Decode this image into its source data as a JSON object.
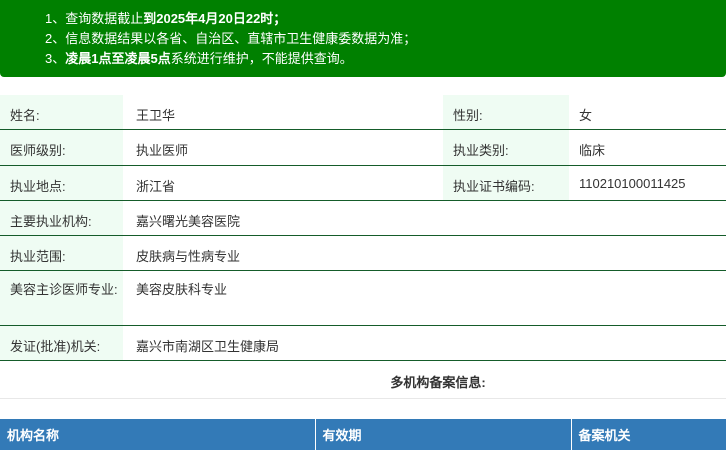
{
  "notice": {
    "item1_prefix": "1、查询数据截止",
    "item1_bold": "到2025年4月20日22时；",
    "item2": "2、信息数据结果以各省、自治区、直辖市卫生健康委数据为准；",
    "item3_prefix": "3、",
    "item3_bold": "凌晨1点至凌晨5点",
    "item3_suffix": "系统进行维护，不能提供查询。"
  },
  "info": {
    "name_label": "姓名:",
    "name_value": "王卫华",
    "gender_label": "性别:",
    "gender_value": "女",
    "level_label": "医师级别:",
    "level_value": "执业医师",
    "category_label": "执业类别:",
    "category_value": "临床",
    "location_label": "执业地点:",
    "location_value": "浙江省",
    "cert_label": "执业证书编码:",
    "cert_value": "110210100011425",
    "institution_label": "主要执业机构:",
    "institution_value": "嘉兴曙光美容医院",
    "scope_label": "执业范围:",
    "scope_value": "皮肤病与性病专业",
    "cosmetic_label": "美容主诊医师专业:",
    "cosmetic_value": "美容皮肤科专业",
    "authority_label": "发证(批准)机关:",
    "authority_value": "嘉兴市南湖区卫生健康局"
  },
  "multi": {
    "title": "多机构备案信息:",
    "col_institution": "机构名称",
    "col_validity": "有效期",
    "col_authority": "备案机关"
  }
}
